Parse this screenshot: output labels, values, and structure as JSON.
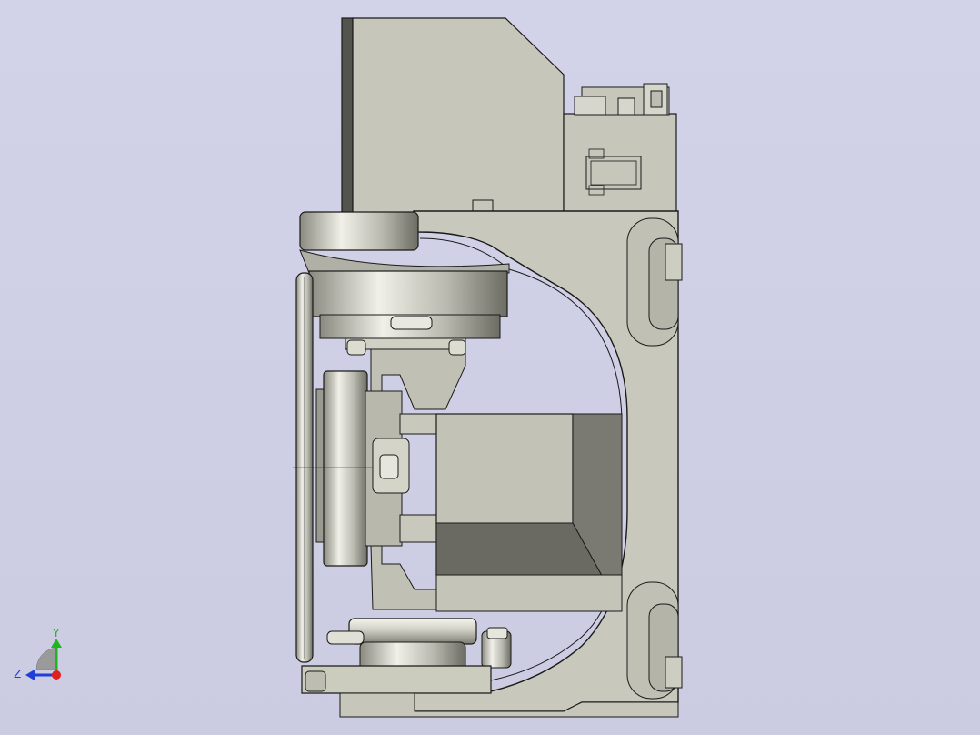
{
  "viewport": {
    "background": "#cfcfe6",
    "model": {
      "body_color": "#c4c4b8",
      "edge_color": "#1a1a1a",
      "shadow_color": "#6e6e66",
      "steel_light": "#f2f2ea",
      "steel_dark": "#7a7a70"
    }
  },
  "triad": {
    "y_label": "Y",
    "z_label": "Z",
    "y_color": "#1fb51f",
    "z_color": "#1f3fd8",
    "x_color": "#e01f1f"
  }
}
